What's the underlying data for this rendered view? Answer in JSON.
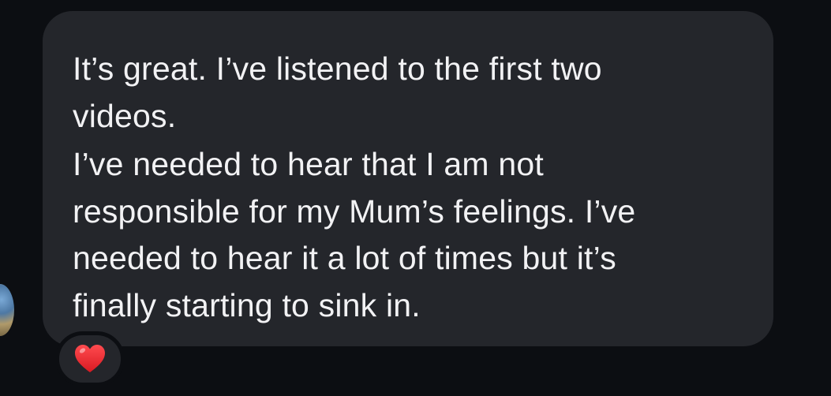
{
  "message": {
    "paragraphs": [
      {
        "lines": [
          "It’s great. I’ve listened to the first two",
          "videos."
        ]
      },
      {
        "lines": [
          "I’ve needed to hear that I am not",
          "responsible for my Mum’s feelings. I’ve",
          "needed to hear it a lot of times but it’s",
          "finally starting to sink in."
        ]
      }
    ]
  },
  "reaction": {
    "icon": "red-heart-icon",
    "color": "#e8262d"
  },
  "colors": {
    "background": "#0c0e12",
    "bubble": "#24262b",
    "text": "#f2f2f4"
  }
}
